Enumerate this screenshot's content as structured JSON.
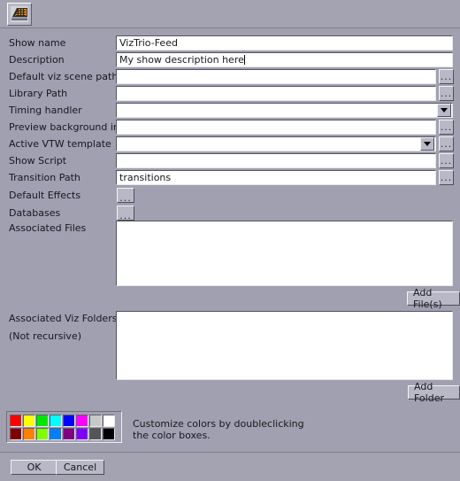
{
  "toolbar": {
    "icon_name": "viz-stage-icon"
  },
  "form": {
    "fields": [
      {
        "label": "Show name",
        "value": "VizTrio-Feed",
        "type": "text"
      },
      {
        "label": "Description",
        "value": "My show description here",
        "type": "text"
      },
      {
        "label": "Default viz scene path",
        "value": "",
        "type": "text-browse"
      },
      {
        "label": "Library Path",
        "value": "",
        "type": "text-browse"
      },
      {
        "label": "Timing handler",
        "value": "",
        "type": "combo"
      },
      {
        "label": "Preview background image",
        "value": "",
        "type": "text-browse"
      },
      {
        "label": "Active VTW template",
        "value": "",
        "type": "combo-browse"
      },
      {
        "label": "Show Script",
        "value": "",
        "type": "text-browse"
      },
      {
        "label": "Transition Path",
        "value": "transitions",
        "type": "text-browse"
      },
      {
        "label": "Default Effects",
        "value": "",
        "type": "button-browse"
      },
      {
        "label": "Databases",
        "value": "",
        "type": "button-browse"
      }
    ],
    "associated_files": {
      "label": "Associated Files",
      "items": [],
      "add_button": "Add File(s)"
    },
    "associated_viz_folders": {
      "label": "Associated Viz Folders",
      "sublabel": "(Not recursive)",
      "items": [],
      "add_button": "Add Folder"
    },
    "browse_button_label": "..."
  },
  "palette": {
    "hint": "Customize colors by doubleclicking\nthe color boxes.",
    "row1": [
      "#ff0000",
      "#ffff00",
      "#00e800",
      "#00ffff",
      "#0000ff",
      "#ff00ff",
      "#c8c8c8",
      "#ffffff"
    ],
    "row2": [
      "#800000",
      "#ff8000",
      "#80ff00",
      "#0080ff",
      "#800080",
      "#8000ff",
      "#555555",
      "#000000"
    ]
  },
  "footer": {
    "ok_label": "OK",
    "cancel_label": "Cancel"
  }
}
